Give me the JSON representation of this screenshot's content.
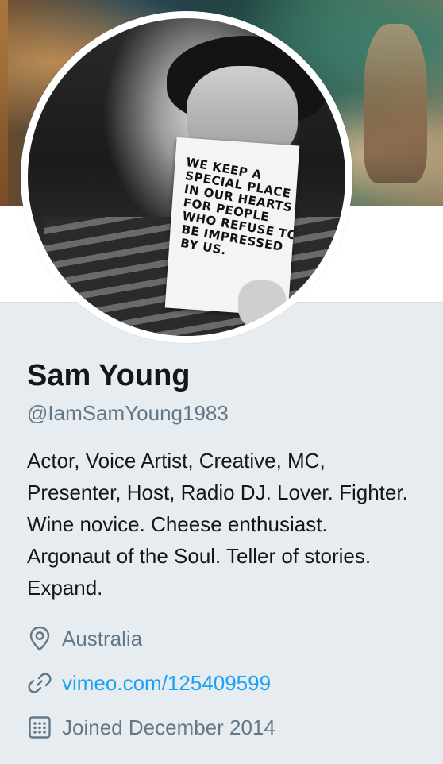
{
  "profile": {
    "name": "Sam Young",
    "handle": "@IamSamYoung1983",
    "bio_lines": [
      "Actor, Voice Artist, Creative, MC,",
      "Presenter, Host, Radio DJ. Lover. Fighter.",
      "Wine novice. Cheese enthusiast.",
      "Argonaut of the Soul. Teller of stories.",
      "Expand."
    ],
    "location": "Australia",
    "website": "vimeo.com/125409599",
    "joined": "Joined December 2014"
  },
  "avatar": {
    "card_lines": [
      "WE KEEP A",
      "SPECIAL PLACE",
      "IN OUR HEARTS",
      "FOR PEOPLE",
      "WHO REFUSE TO",
      "BE IMPRESSED",
      "BY US."
    ]
  },
  "icons": {
    "location": "location-pin-icon",
    "website": "link-icon",
    "joined": "calendar-icon"
  },
  "colors": {
    "background": "#e6ecf0",
    "text_primary": "#14171a",
    "text_secondary": "#657786",
    "link": "#1da1f2"
  }
}
